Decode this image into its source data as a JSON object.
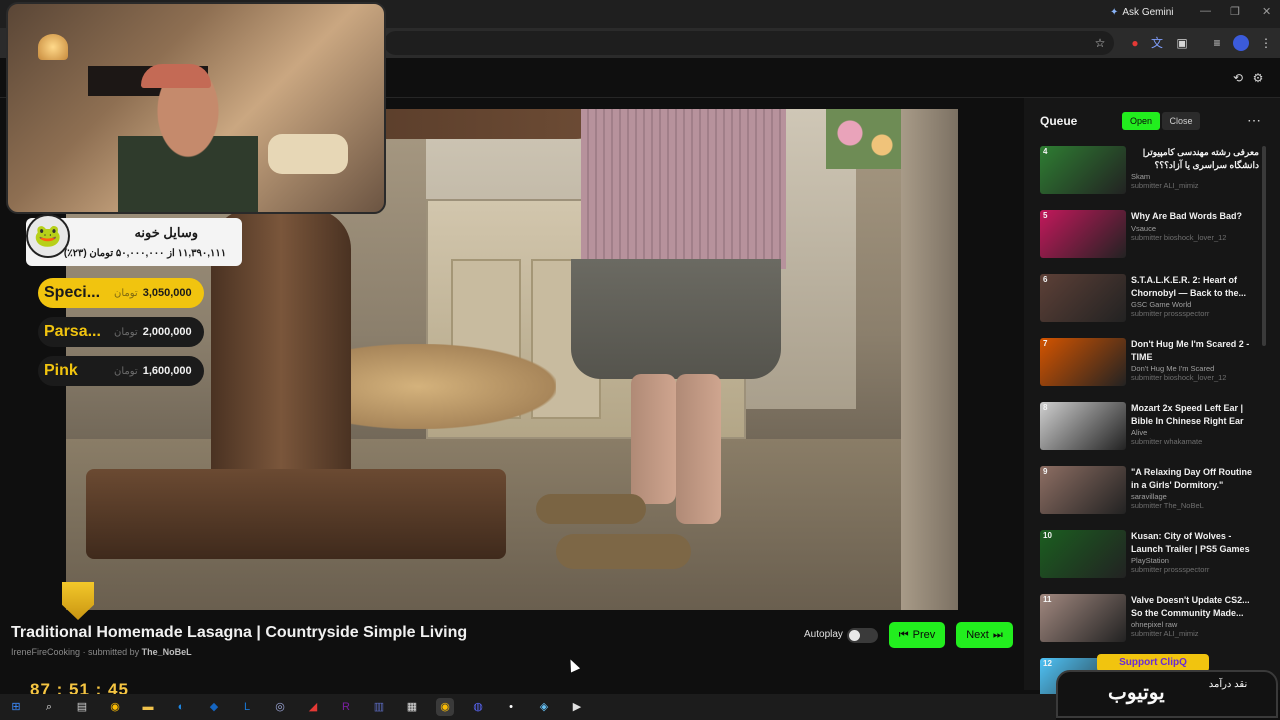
{
  "browser": {
    "ask_gemini": "Ask Gemini",
    "gemini_icon": "sparkle-icon"
  },
  "video": {
    "title": "Traditional Homemade Lasagna | Countryside Simple Living",
    "channel": "IreneFireCooking",
    "submitted_by_label": "· submitted by",
    "submitter": "The_NoBeL",
    "autoplay_label": "Autoplay",
    "autoplay_on": false,
    "prev_label": "Prev",
    "next_label": "Next"
  },
  "donation": {
    "title": "وسایل خونه",
    "subtitle": "۱۱,۳۹۰,۱۱۱ از ۵۰,۰۰۰,۰۰۰ تومان (۲۳٪)",
    "progress_percent": 23
  },
  "leaderboard": [
    {
      "name": "Speci...",
      "currency": "تومان",
      "amount": "3,050,000",
      "bg": "#f1c40f",
      "fg": "#1a1a1a"
    },
    {
      "name": "Parsa...",
      "currency": "تومان",
      "amount": "2,000,000",
      "bg": "#1b1b1b",
      "fg": "#f1c40f"
    },
    {
      "name": "Pink",
      "currency": "تومان",
      "amount": "1,600,000",
      "bg": "#1b1b1b",
      "fg": "#f1c40f"
    }
  ],
  "queue": {
    "title": "Queue",
    "open_label": "Open",
    "close_label": "Close",
    "items": [
      {
        "num": "4",
        "title": "معرفی رشته مهندسی کامپیوتر| دانشگاه سراسری یا آزاد؟؟؟",
        "channel": "Skam",
        "submitter": "submitter ALI_mimiz",
        "thumb": "#2e7d32"
      },
      {
        "num": "5",
        "title": "Why Are Bad Words Bad?",
        "channel": "Vsauce",
        "submitter": "submitter bioshock_lover_12",
        "thumb": "#c2185b"
      },
      {
        "num": "6",
        "title": "S.T.A.L.K.E.R. 2: Heart of Chornobyl — Back to the...",
        "channel": "GSC Game World",
        "submitter": "submitter prossspectorr",
        "thumb": "#5d4037"
      },
      {
        "num": "7",
        "title": "Don't Hug Me I'm Scared 2 - TIME",
        "channel": "Don't Hug Me I'm Scared",
        "submitter": "submitter bioshock_lover_12",
        "thumb": "#d35400"
      },
      {
        "num": "8",
        "title": "Mozart 2x Speed Left Ear | Bible In Chinese Right Ear",
        "channel": "Alive",
        "submitter": "submitter whakamate",
        "thumb": "#cfcfcf"
      },
      {
        "num": "9",
        "title": "\"A Relaxing Day Off Routine in a Girls' Dormitory.\"",
        "channel": "saravillage",
        "submitter": "submitter The_NoBeL",
        "thumb": "#8d6e63"
      },
      {
        "num": "10",
        "title": "Kusan: City of Wolves - Launch Trailer | PS5 Games",
        "channel": "PlayStation",
        "submitter": "submitter prossspectorr",
        "thumb": "#1b5e20"
      },
      {
        "num": "11",
        "title": "Valve Doesn't Update CS2... So the Community Made...",
        "channel": "ohnepixel raw",
        "submitter": "submitter ALI_mimiz",
        "thumb": "#a1887f"
      },
      {
        "num": "12",
        "title": "",
        "channel": "",
        "submitter": "",
        "thumb": "#4fc3f7"
      }
    ]
  },
  "support": {
    "label": "Support ClipQ"
  },
  "brand": {
    "main": "یوتیوب",
    "side": "نقد درآمد"
  },
  "timer": {
    "text": "87 : 51 : 45"
  },
  "taskbar_icons": [
    "windows-icon",
    "search-icon",
    "task-view-icon",
    "chrome-icon",
    "file-explorer-icon",
    "edge-icon",
    "app-blue-icon",
    "app-l-icon",
    "app-circle-icon",
    "app-red-icon",
    "app-r-icon",
    "app-purple-icon",
    "app-window-icon",
    "chrome-active-icon",
    "discord-icon",
    "app-dot-icon",
    "steam-icon",
    "media-player-icon"
  ]
}
